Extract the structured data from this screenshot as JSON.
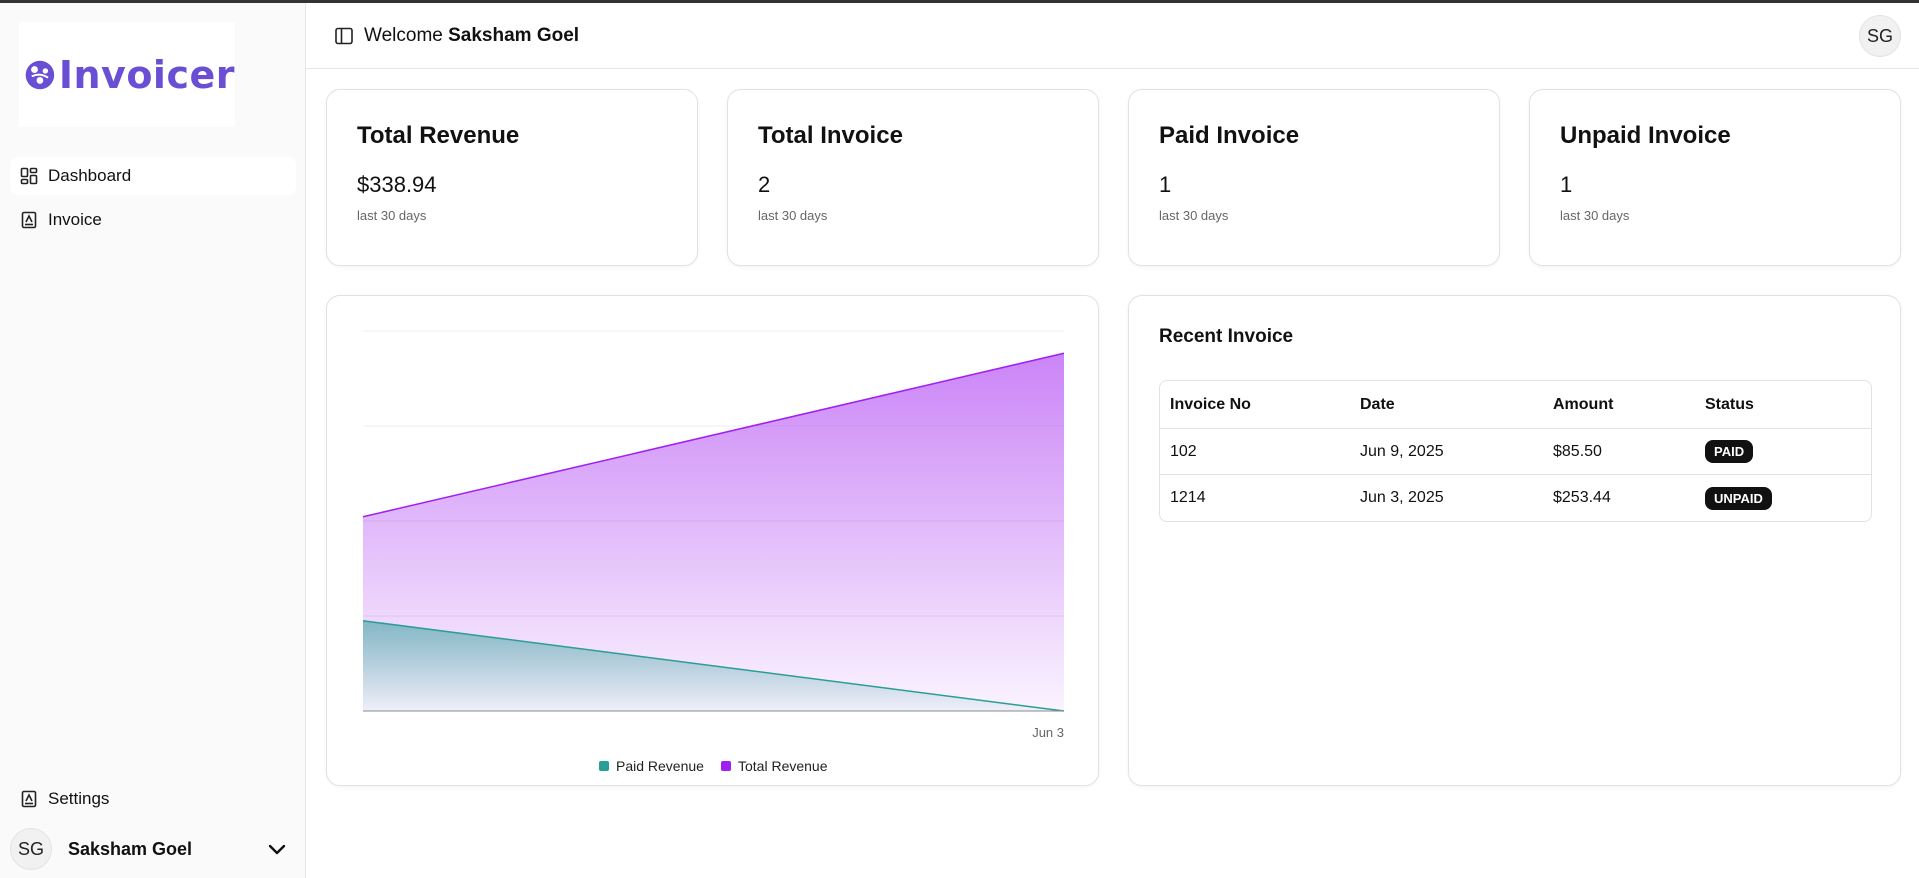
{
  "brand": {
    "name": "Invoicer",
    "color": "#6a4fd4"
  },
  "sidebar": {
    "items": [
      {
        "label": "Dashboard",
        "icon": "dashboard-icon",
        "active": true
      },
      {
        "label": "Invoice",
        "icon": "invoice-icon",
        "active": false
      }
    ],
    "settings_label": "Settings",
    "user": {
      "initials": "SG",
      "name": "Saksham Goel"
    }
  },
  "header": {
    "welcome_prefix": "Welcome",
    "user_name": "Saksham Goel",
    "avatar_initials": "SG"
  },
  "stats": [
    {
      "title": "Total Revenue",
      "value": "$338.94",
      "sub": "last 30 days"
    },
    {
      "title": "Total Invoice",
      "value": "2",
      "sub": "last 30 days"
    },
    {
      "title": "Paid Invoice",
      "value": "1",
      "sub": "last 30 days"
    },
    {
      "title": "Unpaid Invoice",
      "value": "1",
      "sub": "last 30 days"
    }
  ],
  "chart_data": {
    "type": "area",
    "x": [
      "",
      "Jun 3"
    ],
    "x_tick_labels": [
      "Jun 3"
    ],
    "ylim": [
      0,
      360
    ],
    "grid": true,
    "legend_position": "bottom",
    "series": [
      {
        "name": "Paid Revenue",
        "values": [
          85.5,
          0
        ],
        "color": "#2a9d96"
      },
      {
        "name": "Total Revenue",
        "values": [
          184,
          338.94
        ],
        "color": "#a020f0"
      }
    ]
  },
  "recent": {
    "title": "Recent Invoice",
    "columns": [
      "Invoice No",
      "Date",
      "Amount",
      "Status"
    ],
    "rows": [
      {
        "no": "102",
        "date": "Jun 9, 2025",
        "amount": "$85.50",
        "status": "PAID"
      },
      {
        "no": "1214",
        "date": "Jun 3, 2025",
        "amount": "$253.44",
        "status": "UNPAID"
      }
    ]
  }
}
